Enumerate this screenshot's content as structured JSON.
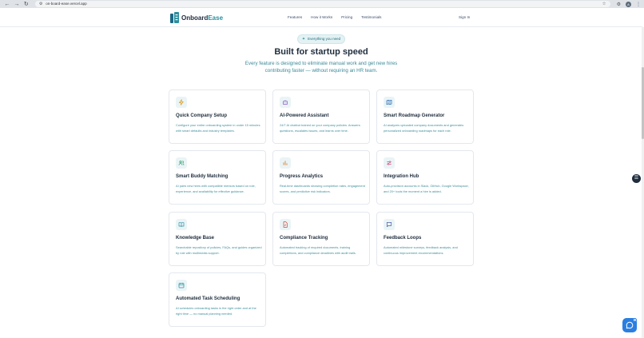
{
  "browser": {
    "url": "on-board-ease.vercel.app",
    "profile_initial": "A"
  },
  "navbar": {
    "brand_part1": "Onboard",
    "brand_part2": "Ease",
    "links": [
      "Features",
      "How it Works",
      "Pricing",
      "Testimonials"
    ],
    "signin": "Sign In"
  },
  "hero": {
    "pill": "Everything you need",
    "title": "Built for startup speed",
    "subtitle": "Every feature is designed to eliminate manual work and get new hires contributing faster — without requiring an HR team."
  },
  "features": [
    {
      "icon": "zap-icon",
      "title": "Quick Company Setup",
      "desc": "Configure your entire onboarding system in under 15 minutes with smart defaults and industry templates."
    },
    {
      "icon": "bot-icon",
      "title": "AI-Powered Assistant",
      "desc": "24/7 AI chatbot trained on your company policies. Answers questions, escalates issues, and learns over time."
    },
    {
      "icon": "map-icon",
      "title": "Smart Roadmap Generator",
      "desc": "AI analyzes uploaded company documents and generates personalized onboarding roadmaps for each role."
    },
    {
      "icon": "users-icon",
      "title": "Smart Buddy Matching",
      "desc": "AI pairs new hires with compatible mentors based on role, experience, and availability for effective guidance."
    },
    {
      "icon": "bar-chart-icon",
      "title": "Progress Analytics",
      "desc": "Real-time dashboards showing completion rates, engagement scores, and predictive risk indicators."
    },
    {
      "icon": "integration-icon",
      "title": "Integration Hub",
      "desc": "Auto-provision accounts in Slack, GitHub, Google Workspace, and 20+ tools the moment a hire is added."
    },
    {
      "icon": "book-icon",
      "title": "Knowledge Base",
      "desc": "Searchable repository of policies, FAQs, and guides organized by role with multimedia support."
    },
    {
      "icon": "file-check-icon",
      "title": "Compliance Tracking",
      "desc": "Automated tracking of required documents, training completions, and compliance deadlines with audit trails."
    },
    {
      "icon": "message-icon",
      "title": "Feedback Loops",
      "desc": "Automated milestone surveys, feedback analysis, and continuous improvement recommendations."
    },
    {
      "icon": "calendar-icon",
      "title": "Automated Task Scheduling",
      "desc": "AI schedules onboarding tasks in the right order and at the right time — no manual planning needed."
    }
  ],
  "floating": {
    "chat_badge": "1"
  },
  "colors": {
    "accent": "#2b8f9e",
    "icon_bg": "#eaf4f6",
    "chat": "#2b7fe0"
  }
}
